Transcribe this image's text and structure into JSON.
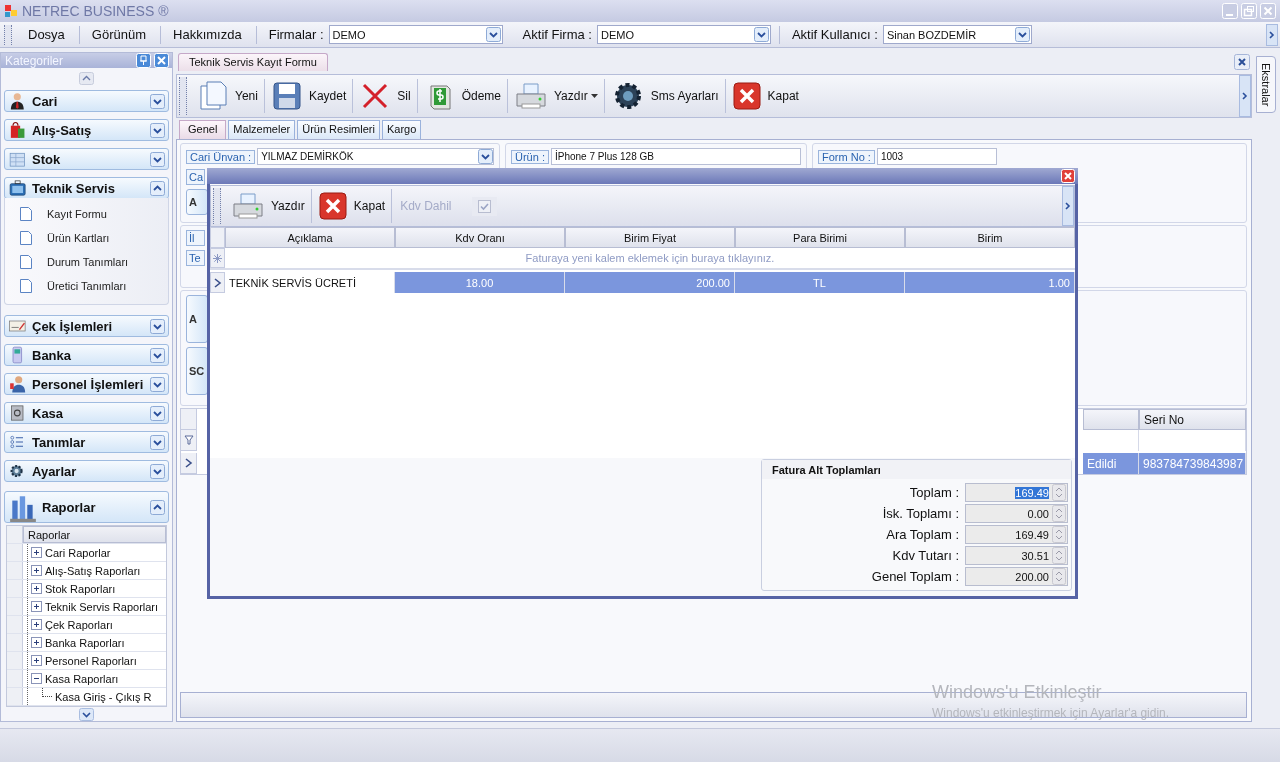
{
  "window": {
    "title": "NETREC BUSINESS ®"
  },
  "menu": {
    "items": [
      "Dosya",
      "Görünüm",
      "Hakkımızda"
    ],
    "combos": [
      {
        "label": "Firmalar :",
        "value": "DEMO"
      },
      {
        "label": "Aktif Firma :",
        "value": "DEMO"
      },
      {
        "label": "Aktif Kullanıcı :",
        "value": "Sinan BOZDEMİR"
      }
    ]
  },
  "sidebar": {
    "title": "Kategoriler",
    "groups": [
      {
        "label": "Cari",
        "expanded": false
      },
      {
        "label": "Alış-Satış",
        "expanded": false
      },
      {
        "label": "Stok",
        "expanded": false
      },
      {
        "label": "Teknik Servis",
        "expanded": true,
        "items": [
          "Kayıt Formu",
          "Ürün Kartları",
          "Durum Tanımları",
          "Üretici Tanımları"
        ]
      },
      {
        "label": "Çek İşlemleri",
        "expanded": false
      },
      {
        "label": "Banka",
        "expanded": false
      },
      {
        "label": "Personel İşlemleri",
        "expanded": false
      },
      {
        "label": "Kasa",
        "expanded": false
      },
      {
        "label": "Tanımlar",
        "expanded": false
      },
      {
        "label": "Ayarlar",
        "expanded": false
      },
      {
        "label": "Raporlar",
        "expanded": true,
        "tree": {
          "header": "Raporlar",
          "nodes": [
            {
              "label": "Cari Raporlar",
              "expanded": false
            },
            {
              "label": "Alış-Satış Raporları",
              "expanded": false
            },
            {
              "label": "Stok Raporları",
              "expanded": false
            },
            {
              "label": "Teknik Servis Raporları",
              "expanded": false
            },
            {
              "label": "Çek Raporları",
              "expanded": false
            },
            {
              "label": "Banka Raporları",
              "expanded": false
            },
            {
              "label": "Personel Raporları",
              "expanded": false
            },
            {
              "label": "Kasa Raporları",
              "expanded": true,
              "children": [
                {
                  "label": "Kasa Giriş - Çıkış R"
                }
              ]
            }
          ]
        }
      }
    ]
  },
  "document_tabs": [
    {
      "label": "Teknik Servis Kayıt Formu",
      "selected": true
    }
  ],
  "toolbar": [
    {
      "label": "Yeni",
      "kind": "new"
    },
    {
      "label": "Kaydet",
      "kind": "save"
    },
    {
      "label": "Sil",
      "kind": "delete"
    },
    {
      "label": "Ödeme",
      "kind": "payment"
    },
    {
      "label": "Yazdır",
      "kind": "print",
      "dropdown": true
    },
    {
      "label": "Sms Ayarları",
      "kind": "settings"
    },
    {
      "label": "Kapat",
      "kind": "close"
    }
  ],
  "form_tabs": [
    {
      "label": "Genel",
      "selected": true
    },
    {
      "label": "Malzemeler",
      "selected": false
    },
    {
      "label": "Ürün Resimleri",
      "selected": false
    },
    {
      "label": "Kargo",
      "selected": false
    }
  ],
  "form_rows": [
    {
      "panels": [
        {
          "items": [
            {
              "kind": "field",
              "label": "Cari Ünvan :",
              "value": "YILMAZ DEMİRKÖK",
              "dropdown": true
            },
            {
              "kind": "chip",
              "text": "Ca"
            },
            {
              "kind": "button",
              "text": "A"
            }
          ]
        },
        {
          "items": [
            {
              "kind": "field",
              "label": "Ürün :",
              "value": "İPhone 7 Plus 128 GB"
            }
          ]
        },
        {
          "items": [
            {
              "kind": "field",
              "label": "Form No :",
              "value": "1003"
            }
          ]
        }
      ]
    },
    {
      "panels": [
        {
          "items": [
            {
              "kind": "chip",
              "text": "İl"
            },
            {
              "kind": "chip",
              "text": "Te"
            }
          ]
        }
      ]
    },
    {
      "panels": [
        {
          "items": [
            {
              "kind": "button",
              "text": "A"
            },
            {
              "kind": "button",
              "text": "SC"
            }
          ]
        }
      ]
    }
  ],
  "grid": {
    "columns": [
      {
        "label": "Seri No"
      }
    ],
    "rows": [
      {
        "selected": true,
        "partial_cell": "Edildi",
        "cells": [
          "983784739843987"
        ]
      }
    ]
  },
  "right_tab": "Ekstralar",
  "dialog": {
    "toolbar": [
      {
        "label": "Yazdır",
        "kind": "print"
      },
      {
        "label": "Kapat",
        "kind": "close"
      }
    ],
    "kdv_dahil": {
      "label": "Kdv Dahil",
      "checked": true,
      "disabled": true
    },
    "columns": [
      "Açıklama",
      "Kdv Oranı",
      "Birim Fiyat",
      "Para Birimi",
      "Birim"
    ],
    "new_row_hint": "Faturaya yeni kalem eklemek için buraya tıklayınız.",
    "rows": [
      {
        "selected": true,
        "cells": [
          {
            "text": "TEKNİK SERVİS ÜCRETİ",
            "focused": true
          },
          {
            "text": "18.00",
            "focused": false
          },
          {
            "text": "200.00",
            "focused": false
          },
          {
            "text": "TL",
            "focused": false
          },
          {
            "text": "1.00",
            "focused": false
          }
        ]
      }
    ],
    "totals": {
      "title": "Fatura Alt Toplamları",
      "rows": [
        {
          "label": "Toplam :",
          "value": "169.49",
          "selected": true
        },
        {
          "label": "İsk. Toplamı :",
          "value": "0.00",
          "selected": false
        },
        {
          "label": "Ara Toplam :",
          "value": "169.49",
          "selected": false
        },
        {
          "label": "Kdv Tutarı :",
          "value": "30.51",
          "selected": false
        },
        {
          "label": "Genel Toplam :",
          "value": "200.00",
          "selected": false
        }
      ]
    }
  },
  "activation_notice": {
    "title": "Windows'u Etkinleştir",
    "message": "Windows'u etkinleştirmek için Ayarlar'a gidin."
  }
}
